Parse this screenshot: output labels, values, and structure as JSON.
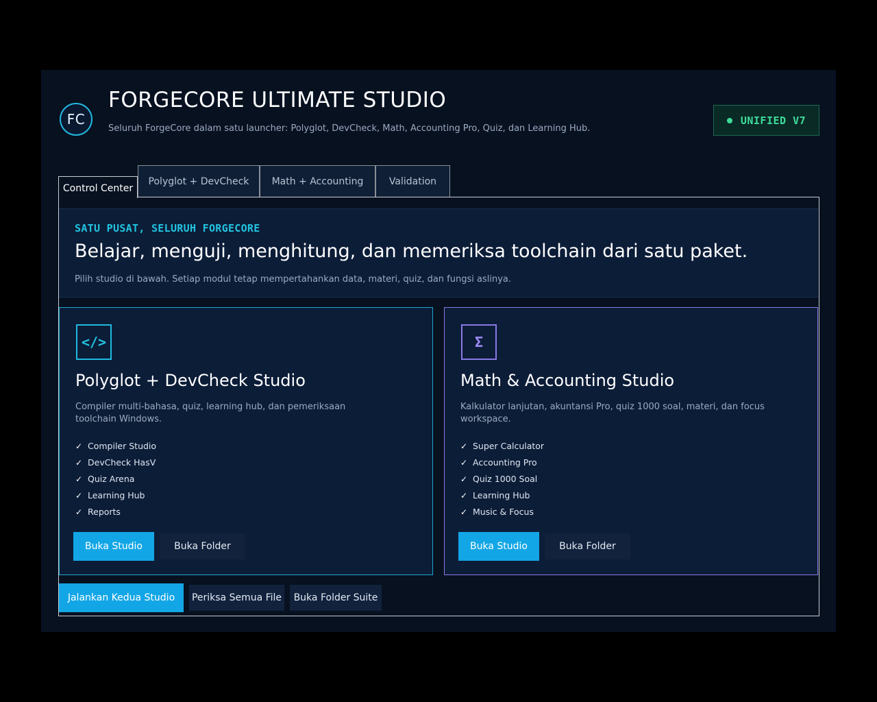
{
  "header": {
    "logo_text": "FC",
    "title": "FORGECORE ULTIMATE STUDIO",
    "subtitle": "Seluruh ForgeCore dalam satu launcher: Polyglot, DevCheck, Math, Accounting Pro, Quiz, dan Learning Hub.",
    "badge": "UNIFIED V7"
  },
  "tabs": [
    {
      "label": "Control Center",
      "active": true
    },
    {
      "label": "Polyglot + DevCheck",
      "active": false
    },
    {
      "label": "Math + Accounting",
      "active": false
    },
    {
      "label": "Validation",
      "active": false
    }
  ],
  "hero": {
    "kicker": "SATU PUSAT, SELURUH FORGECORE",
    "title": "Belajar, menguji, menghitung, dan memeriksa toolchain dari satu paket.",
    "description": "Pilih studio di bawah. Setiap modul tetap mempertahankan data, materi, quiz, dan fungsi aslinya."
  },
  "cards": [
    {
      "icon": "</>",
      "icon_name": "code-icon",
      "accent": "#22b8de",
      "title": "Polyglot + DevCheck Studio",
      "description": "Compiler multi-bahasa, quiz, learning hub, dan pemeriksaan toolchain Windows.",
      "features": [
        "Compiler Studio",
        "DevCheck HasV",
        "Quiz Arena",
        "Learning Hub",
        "Reports"
      ],
      "primary_button": "Buka Studio",
      "secondary_button": "Buka Folder"
    },
    {
      "icon": "Σ",
      "icon_name": "sigma-icon",
      "accent": "#8b78e6",
      "title": "Math & Accounting Studio",
      "description": "Kalkulator lanjutan, akuntansi Pro, quiz 1000 soal, materi, dan focus workspace.",
      "features": [
        "Super Calculator",
        "Accounting Pro",
        "Quiz 1000 Soal",
        "Learning Hub",
        "Music & Focus"
      ],
      "primary_button": "Buka Studio",
      "secondary_button": "Buka Folder"
    }
  ],
  "footer_actions": {
    "run_both": "Jalankan Kedua Studio",
    "check_all": "Periksa Semua File",
    "open_suite_folder": "Buka Folder Suite"
  },
  "colors": {
    "accent_cyan": "#22b8de",
    "accent_purple": "#8b78e6",
    "primary_button": "#12a6e6",
    "badge_green": "#3fdc9a"
  }
}
